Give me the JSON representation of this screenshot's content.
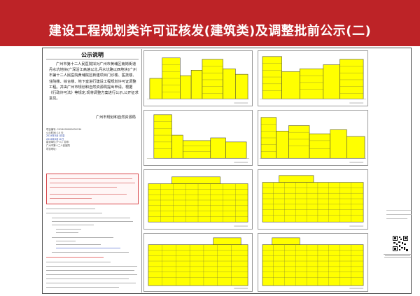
{
  "banner": {
    "title": "建设工程规划类许可证核发(建筑类)及调整批前公示(二)"
  },
  "notice": {
    "heading": "公示说明",
    "body": "广州市第十二人民医院拟对广州市黄埔区南岗街道丹水坑地块(广深沿江高速以北,丹水坑路以西地块)广州市第十二人民医院黄埔院区新建项目门诊楼、医技楼、住院楼、综合楼、地下室进行建设工程规划许可证调整工程。并由广州市规划和自然资源局提出申请。根据《行政许可法》等规定,现将调整方案进行公示,公开征求意见。",
    "organization": "广州市规划和自然资源局"
  },
  "meta_lines": [
    "项目编号: 2024000000000134",
    "公示时间: 10 天",
    "2024年3月1日至",
    "2024年3月11日",
    "建设单位(个人): 名称:",
    "广州市第十二人民医院",
    "项目地址:"
  ],
  "section_labels": [
    "1. 设置方案",
    "2. 有关利害关系人"
  ],
  "colors": {
    "banner": "#bd2327",
    "building": "#ffff00",
    "outline": "#4a4a3a"
  }
}
